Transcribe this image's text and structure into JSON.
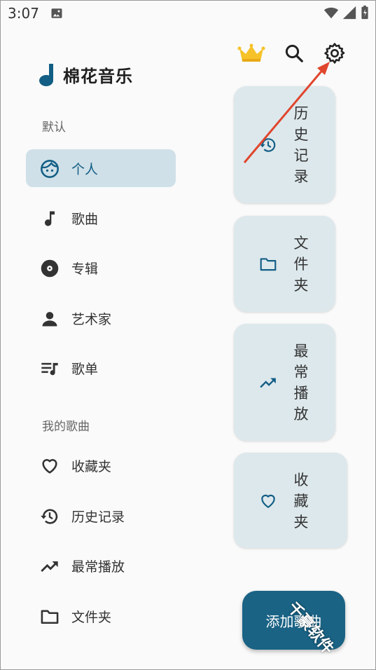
{
  "status_bar": {
    "time": "3:07"
  },
  "app": {
    "title": "棉花音乐"
  },
  "toolbar": {
    "icons": [
      "crown-icon",
      "search-icon",
      "settings-icon"
    ]
  },
  "drawer": {
    "section_default": "默认",
    "items": [
      {
        "label": "个人",
        "icon": "face-icon",
        "active": true
      },
      {
        "label": "歌曲",
        "icon": "music-note-icon"
      },
      {
        "label": "专辑",
        "icon": "album-icon"
      },
      {
        "label": "艺术家",
        "icon": "person-icon"
      },
      {
        "label": "歌单",
        "icon": "playlist-icon"
      }
    ],
    "section_my": "我的歌曲",
    "my_items": [
      {
        "label": "收藏夹",
        "icon": "heart-icon"
      },
      {
        "label": "历史记录",
        "icon": "history-icon"
      },
      {
        "label": "最常播放",
        "icon": "trending-icon"
      },
      {
        "label": "文件夹",
        "icon": "folder-icon"
      }
    ]
  },
  "cards": [
    {
      "label": "历史记录",
      "chars": [
        "历",
        "史",
        "记",
        "录"
      ],
      "icon": "history-icon"
    },
    {
      "label": "文件夹",
      "chars": [
        "文",
        "件",
        "夹"
      ],
      "icon": "folder-icon"
    },
    {
      "label": "最常播放",
      "chars": [
        "最",
        "常",
        "播",
        "放"
      ],
      "icon": "trending-icon"
    },
    {
      "label": "收藏夹",
      "chars": [
        "收",
        "藏",
        "夹"
      ],
      "icon": "heart-icon"
    }
  ],
  "fab": {
    "label": "添加歌曲"
  },
  "watermark": {
    "text": "千豪软件"
  },
  "colors": {
    "accent": "#125e85",
    "fab": "#1a6385",
    "card_bg": "#dde8ec",
    "active_bg": "#cfe0e8",
    "arrow": "#e0452d"
  }
}
